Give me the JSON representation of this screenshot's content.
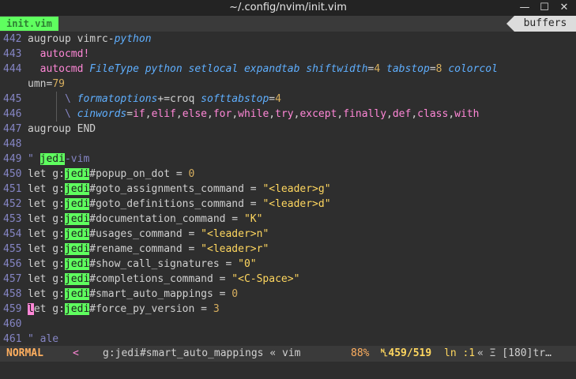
{
  "window": {
    "title": "~/.config/nvim/init.vim",
    "minimize": "—",
    "maximize": "☐",
    "close": "✕"
  },
  "tabline": {
    "active_tab": "init.vim",
    "buffers": "buffers"
  },
  "lines": [
    {
      "n": "442",
      "text": "augroup vimrc-python"
    },
    {
      "n": "443",
      "text": "  autocmd!"
    },
    {
      "n": "444",
      "text": "  autocmd FileType python setlocal expandtab shiftwidth=4 tabstop=8 colorcol"
    },
    {
      "n": "",
      "text": "umn=79"
    },
    {
      "n": "445",
      "text": "      \\ formatoptions+=croq softtabstop=4"
    },
    {
      "n": "446",
      "text": "      \\ cinwords=if,elif,else,for,while,try,except,finally,def,class,with"
    },
    {
      "n": "447",
      "text": "augroup END"
    },
    {
      "n": "448",
      "text": ""
    },
    {
      "n": "449",
      "text": "\" jedi-vim"
    },
    {
      "n": "450",
      "text": "let g:jedi#popup_on_dot = 0"
    },
    {
      "n": "451",
      "text": "let g:jedi#goto_assignments_command = \"<leader>g\""
    },
    {
      "n": "452",
      "text": "let g:jedi#goto_definitions_command = \"<leader>d\""
    },
    {
      "n": "453",
      "text": "let g:jedi#documentation_command = \"K\""
    },
    {
      "n": "454",
      "text": "let g:jedi#usages_command = \"<leader>n\""
    },
    {
      "n": "455",
      "text": "let g:jedi#rename_command = \"<leader>r\""
    },
    {
      "n": "456",
      "text": "let g:jedi#show_call_signatures = \"0\""
    },
    {
      "n": "457",
      "text": "let g:jedi#completions_command = \"<C-Space>\""
    },
    {
      "n": "458",
      "text": "let g:jedi#smart_auto_mappings = 0"
    },
    {
      "n": "459",
      "text": "let g:jedi#force_py_version = 3"
    },
    {
      "n": "460",
      "text": ""
    },
    {
      "n": "461",
      "text": "\" ale"
    }
  ],
  "statusline": {
    "mode": "NORMAL",
    "arrow": "<",
    "function": "g:jedi#smart_auto_mappings « vim",
    "percent": "88%",
    "position": "␤459/519",
    "column": "ln :1",
    "trailing": "« Ξ [180]tr…"
  },
  "colors": {
    "accent_green": "#5fff5f",
    "keyword_pink": "#ff87d7",
    "option_blue": "#5fafff",
    "number_gold": "#d7af5f",
    "string_yellow": "#ffd75f",
    "linenr": "#8585c4",
    "mode_orange": "#ffaf5f"
  },
  "icons": {
    "line_icon": "newline-icon",
    "column_icon": "line-number-icon"
  }
}
